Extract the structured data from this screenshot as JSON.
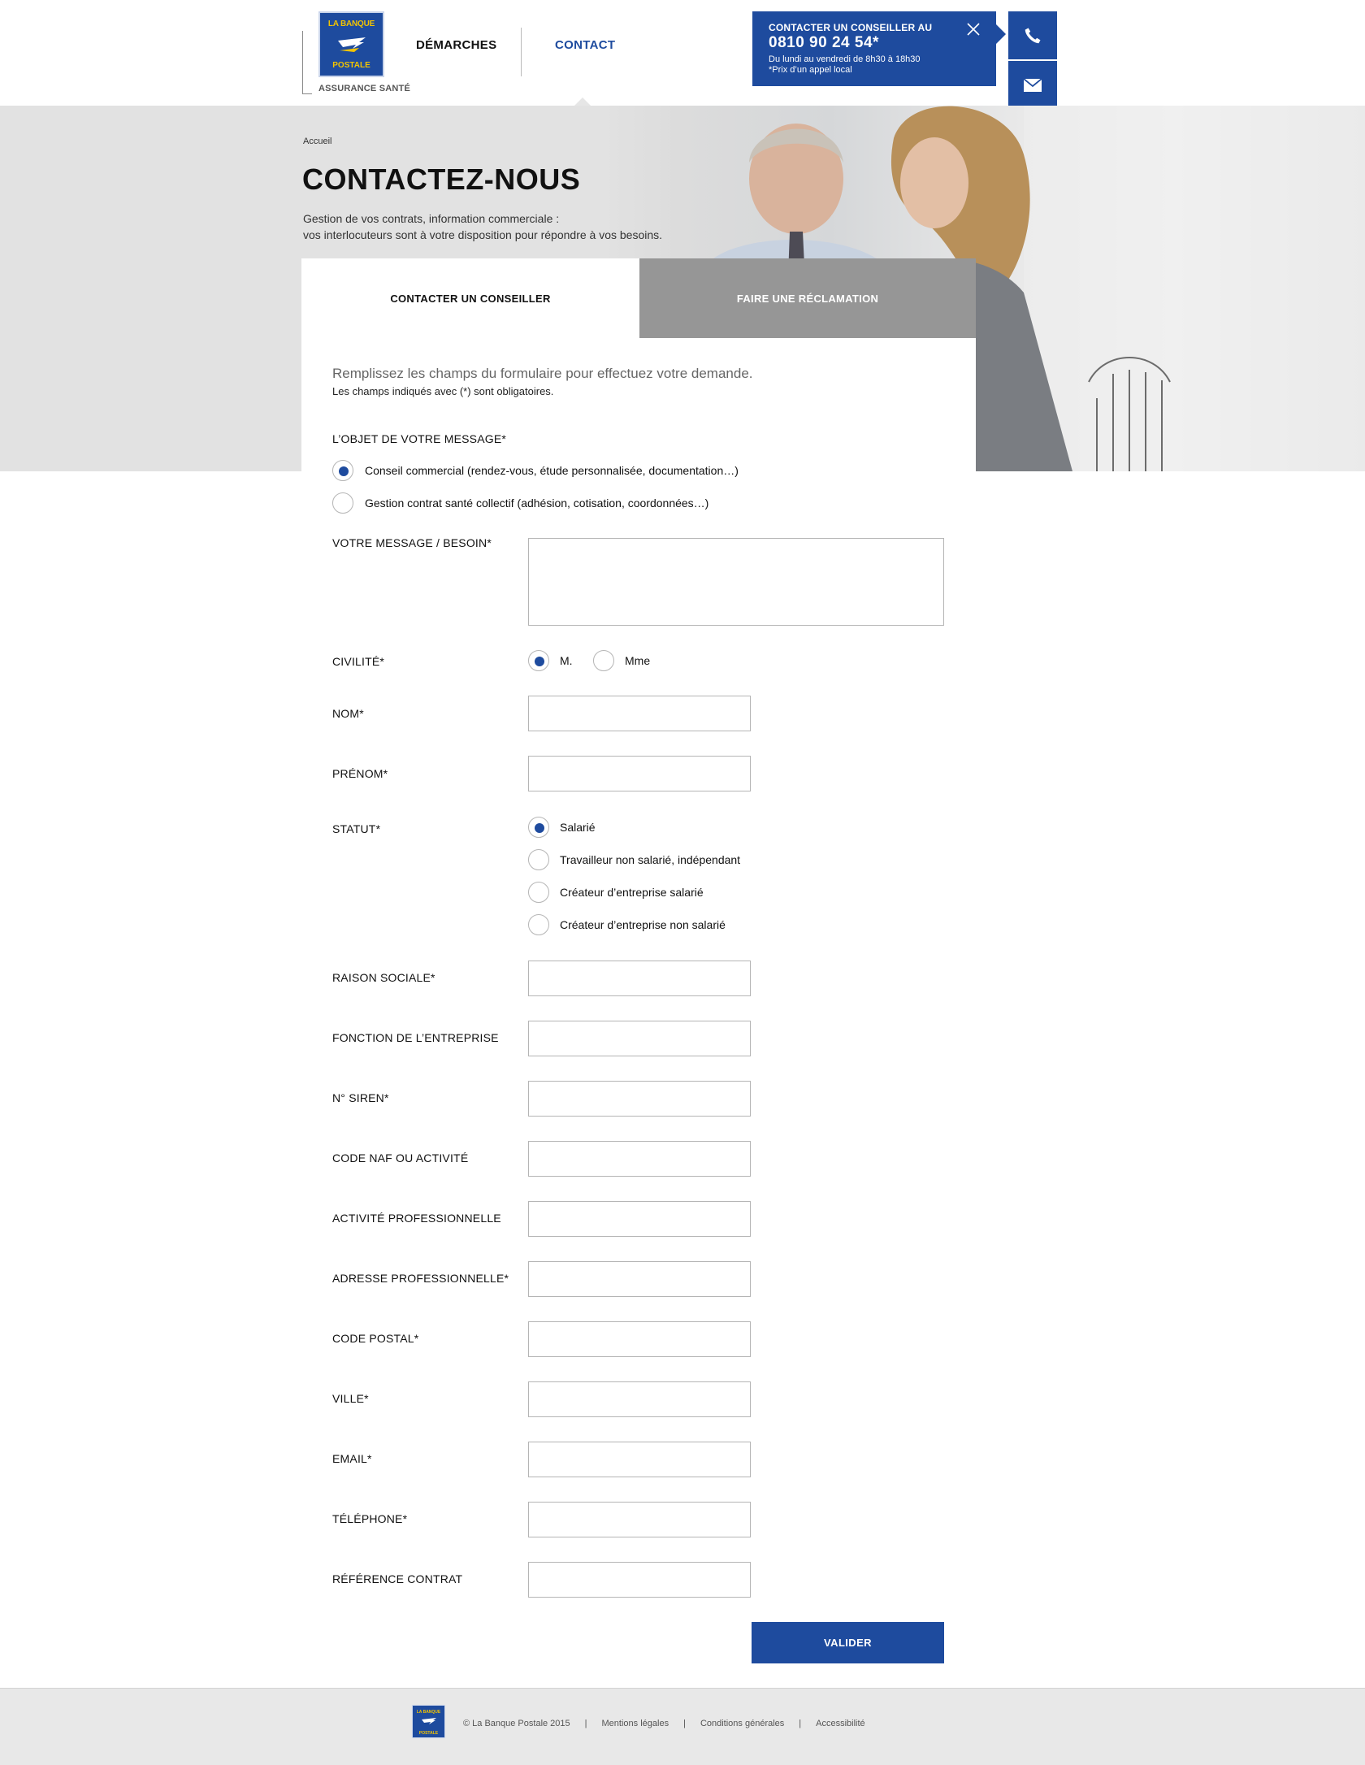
{
  "header": {
    "logo_line1": "LA BANQUE",
    "logo_line2": "POSTALE",
    "logo_subtitle": "ASSURANCE SANTÉ",
    "nav": [
      {
        "label": "DÉMARCHES",
        "active": false
      },
      {
        "label": "CONTACT",
        "active": true
      }
    ],
    "callout": {
      "title": "CONTACTER UN CONSEILLER AU",
      "phone": "0810 90 24 54*",
      "hours": "Du lundi au vendredi de 8h30 à 18h30",
      "note": "*Prix d’un appel local"
    },
    "side_buttons": [
      "phone-icon",
      "mail-icon"
    ]
  },
  "hero": {
    "breadcrumb": "Accueil",
    "title": "CONTACTEZ-NOUS",
    "intro_line1": "Gestion de vos contrats, information commerciale :",
    "intro_line2": "vos interlocuteurs sont à votre disposition pour répondre à vos besoins."
  },
  "tabs": [
    {
      "label": "CONTACTER UN CONSEILLER",
      "active": true
    },
    {
      "label": "FAIRE UNE RÉCLAMATION",
      "active": false
    }
  ],
  "form": {
    "lead": "Remplissez les champs du formulaire pour effectuez votre demande.",
    "mandatory_note": "Les champs indiqués avec (*) sont obligatoires.",
    "objet": {
      "label": "L’OBJET DE VOTRE MESSAGE*",
      "options": [
        {
          "label": "Conseil commercial (rendez-vous, étude personnalisée, documentation…)",
          "checked": true
        },
        {
          "label": "Gestion contrat santé collectif (adhésion, cotisation, coordonnées…)",
          "checked": false
        }
      ]
    },
    "message_label": "VOTRE MESSAGE / BESOIN*",
    "message_value": "",
    "civilite": {
      "label": "CIVILITÉ*",
      "options": [
        {
          "label": "M.",
          "checked": true
        },
        {
          "label": "Mme",
          "checked": false
        }
      ]
    },
    "nom_label": "NOM*",
    "prenom_label": "PRÉNOM*",
    "statut": {
      "label": "STATUT*",
      "options": [
        {
          "label": "Salarié",
          "checked": true
        },
        {
          "label": "Travailleur non salarié, indépendant",
          "checked": false
        },
        {
          "label": "Créateur d’entreprise salarié",
          "checked": false
        },
        {
          "label": "Créateur d’entreprise non salarié",
          "checked": false
        }
      ]
    },
    "fields": [
      {
        "label": "RAISON SOCIALE*",
        "value": ""
      },
      {
        "label": "FONCTION DE L’ENTREPRISE",
        "value": ""
      },
      {
        "label": "N° SIREN*",
        "value": ""
      },
      {
        "label": "CODE NAF OU ACTIVITÉ",
        "value": ""
      },
      {
        "label": "ACTIVITÉ PROFESSIONNELLE",
        "value": ""
      },
      {
        "label": "ADRESSE PROFESSIONNELLE*",
        "value": ""
      },
      {
        "label": "CODE POSTAL*",
        "value": ""
      },
      {
        "label": "VILLE*",
        "value": ""
      },
      {
        "label": "EMAIL*",
        "value": ""
      },
      {
        "label": "TÉLÉPHONE*",
        "value": ""
      },
      {
        "label": "RÉFÉRENCE CONTRAT",
        "value": ""
      }
    ],
    "submit_label": "VALIDER"
  },
  "footer": {
    "logo_line1": "LA BANQUE",
    "logo_line2": "POSTALE",
    "copyright": "© La Banque Postale 2015",
    "links": [
      "Mentions légales",
      "Conditions générales",
      "Accessibilité"
    ]
  },
  "colors": {
    "brand_blue": "#1e4b9e",
    "brand_yellow": "#f3c400",
    "hero_grey": "#e2e2e2",
    "footer_grey": "#e8e8e8"
  }
}
